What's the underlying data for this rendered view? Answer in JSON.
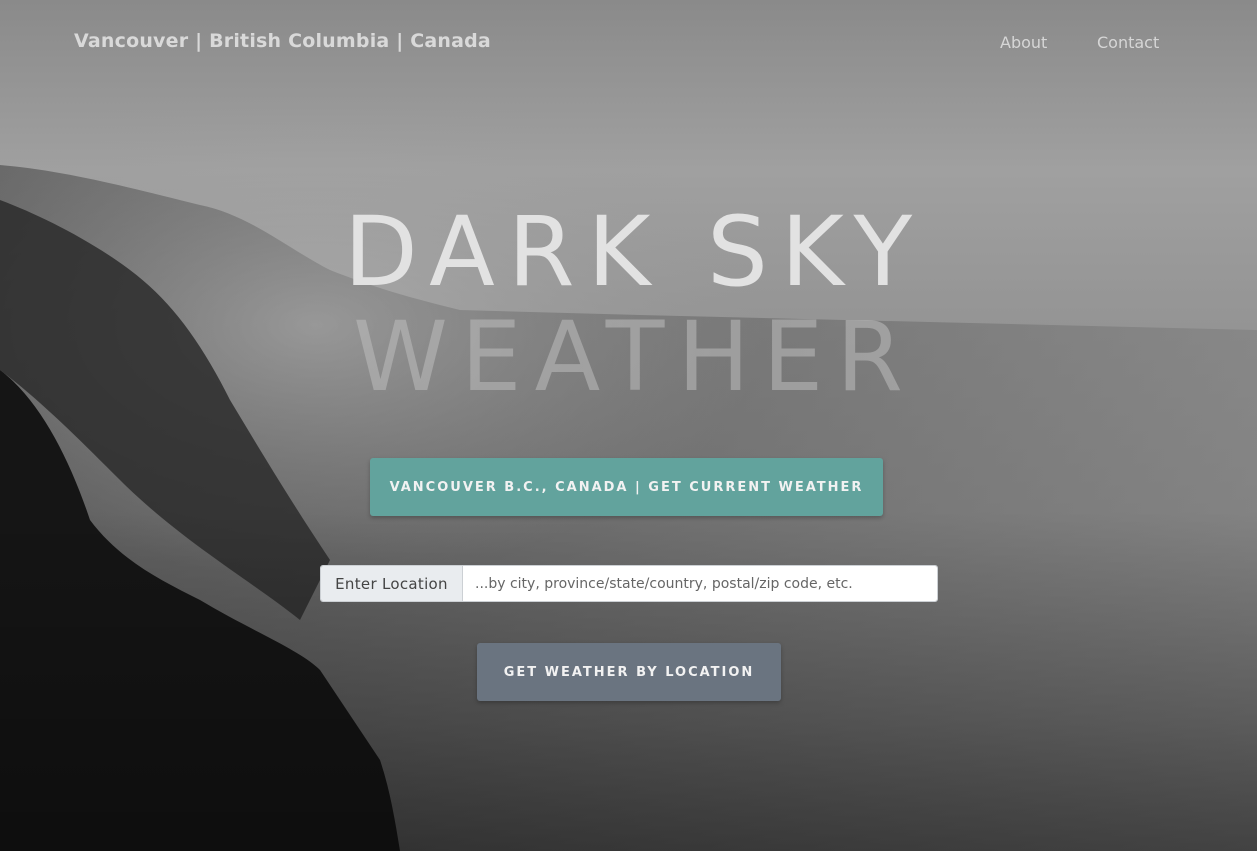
{
  "nav": {
    "brand": "Vancouver | British Columbia | Canada",
    "links": [
      {
        "label": "About"
      },
      {
        "label": "Contact"
      }
    ]
  },
  "hero": {
    "title_line1": "DARK SKY",
    "title_line2": "WEATHER"
  },
  "current_weather_button": {
    "label": "VANCOUVER B.C., CANADA | GET CURRENT WEATHER",
    "color": "#62a39d"
  },
  "location_input": {
    "addon_label": "Enter Location",
    "placeholder": "...by city, province/state/country, postal/zip code, etc.",
    "value": ""
  },
  "location_button": {
    "label": "GET WEATHER BY LOCATION",
    "color": "#6a7480"
  }
}
